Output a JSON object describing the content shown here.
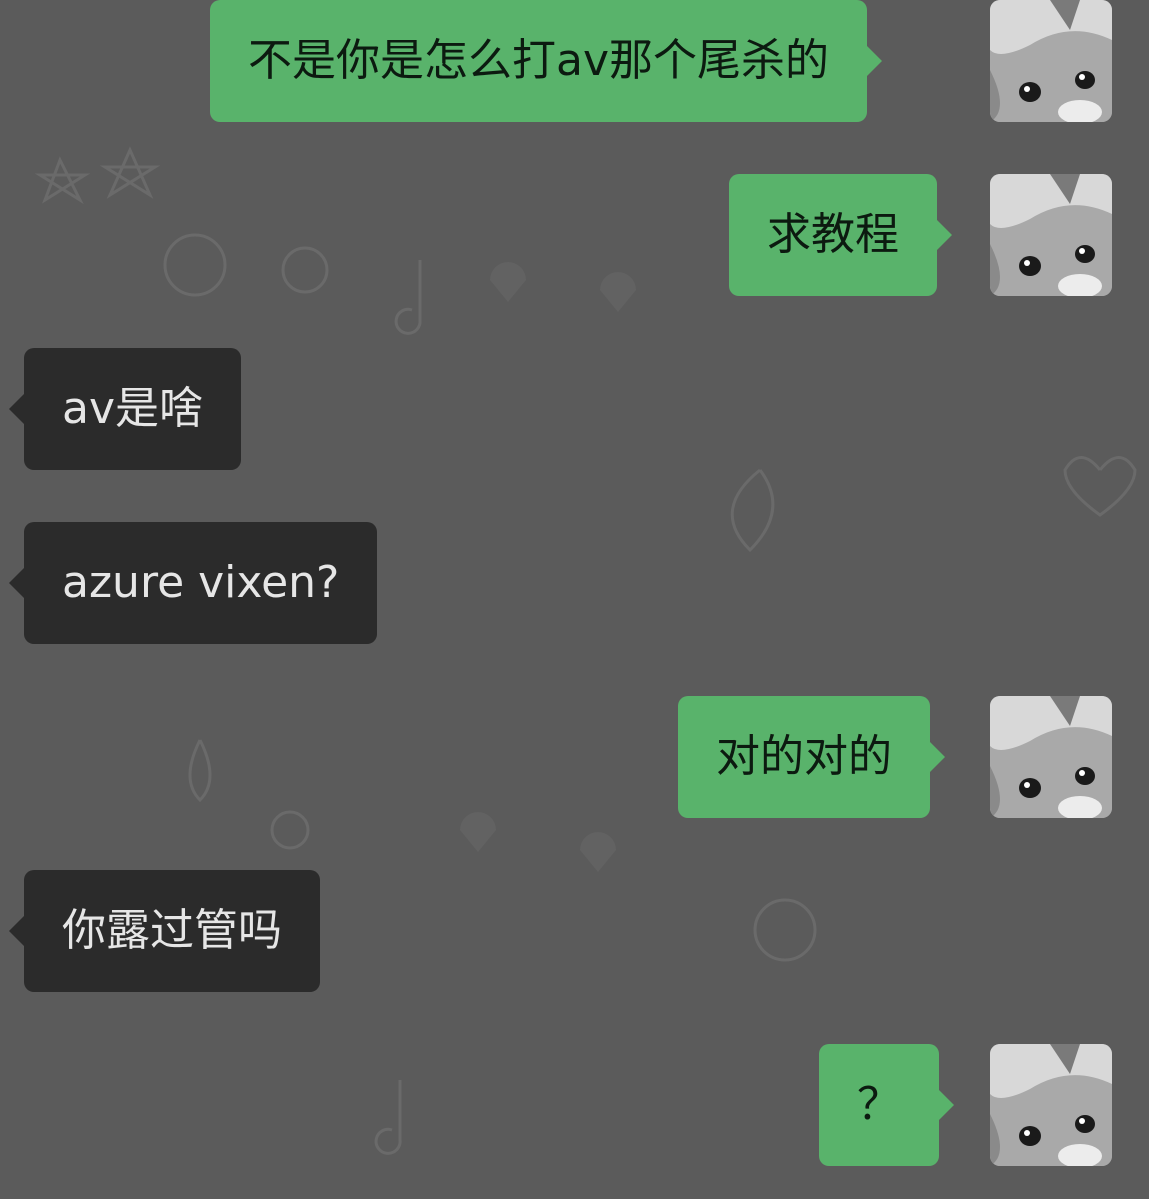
{
  "messages": [
    {
      "dir": "out",
      "text": "不是你是怎么打av那个尾杀的"
    },
    {
      "dir": "out",
      "text": "求教程"
    },
    {
      "dir": "in",
      "text": "av是啥"
    },
    {
      "dir": "in",
      "text": "azure vixen?"
    },
    {
      "dir": "out",
      "text": "对的对的"
    },
    {
      "dir": "in",
      "text": "你露过管吗"
    },
    {
      "dir": "out",
      "text": "？"
    }
  ],
  "avatar_icon": "kitten-avatar-icon",
  "colors": {
    "background": "#5b5b5b",
    "outgoing_bubble": "#59b36b",
    "incoming_bubble": "#2b2b2b"
  }
}
